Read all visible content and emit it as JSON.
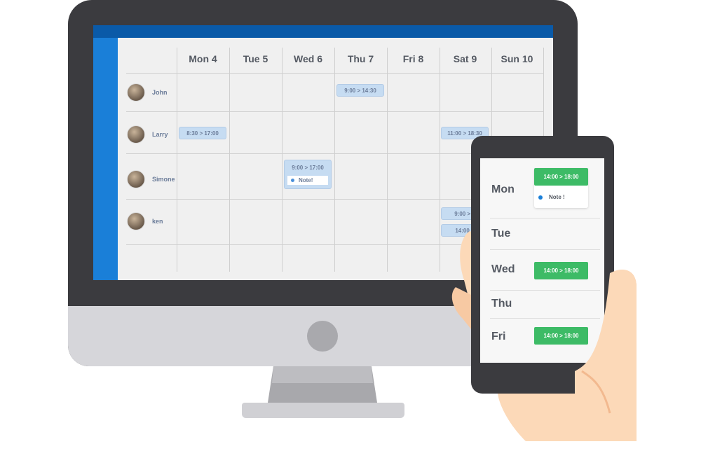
{
  "calendar": {
    "days": [
      "Mon 4",
      "Tue 5",
      "Wed 6",
      "Thu 7",
      "Fri 8",
      "Sat 9",
      "Sun 10"
    ],
    "people": [
      {
        "name": "John",
        "shifts": [
          {
            "day": "Thu 7",
            "time": "9:00  >  14:30"
          }
        ]
      },
      {
        "name": "Larry",
        "shifts": [
          {
            "day": "Mon 4",
            "time": "8:30  >  17:00"
          },
          {
            "day": "Sat 9",
            "time": "11:00  >  18:30"
          }
        ]
      },
      {
        "name": "Simone",
        "shifts": [
          {
            "day": "Wed 6",
            "time": "9:00  >  17:00",
            "note": "Note!"
          }
        ]
      },
      {
        "name": "ken",
        "shifts": [
          {
            "day": "Sat 9",
            "time": "9:00  >  1"
          },
          {
            "day": "Sat 9",
            "time": "14:00  >"
          }
        ]
      }
    ]
  },
  "phone": {
    "days": [
      {
        "label": "Mon",
        "shift": "14:00  >  18:00",
        "note": "Note !"
      },
      {
        "label": "Tue"
      },
      {
        "label": "Wed",
        "shift": "14:00  >  18:00"
      },
      {
        "label": "Thu"
      },
      {
        "label": "Fri",
        "shift": "14:00  >  18:00"
      }
    ]
  },
  "colors": {
    "topbar": "#0a5aa8",
    "sidebar": "#1a7fd8",
    "shift": "#c6dcf2",
    "phone_shift": "#3dbb66",
    "bezel": "#3b3b3f"
  }
}
